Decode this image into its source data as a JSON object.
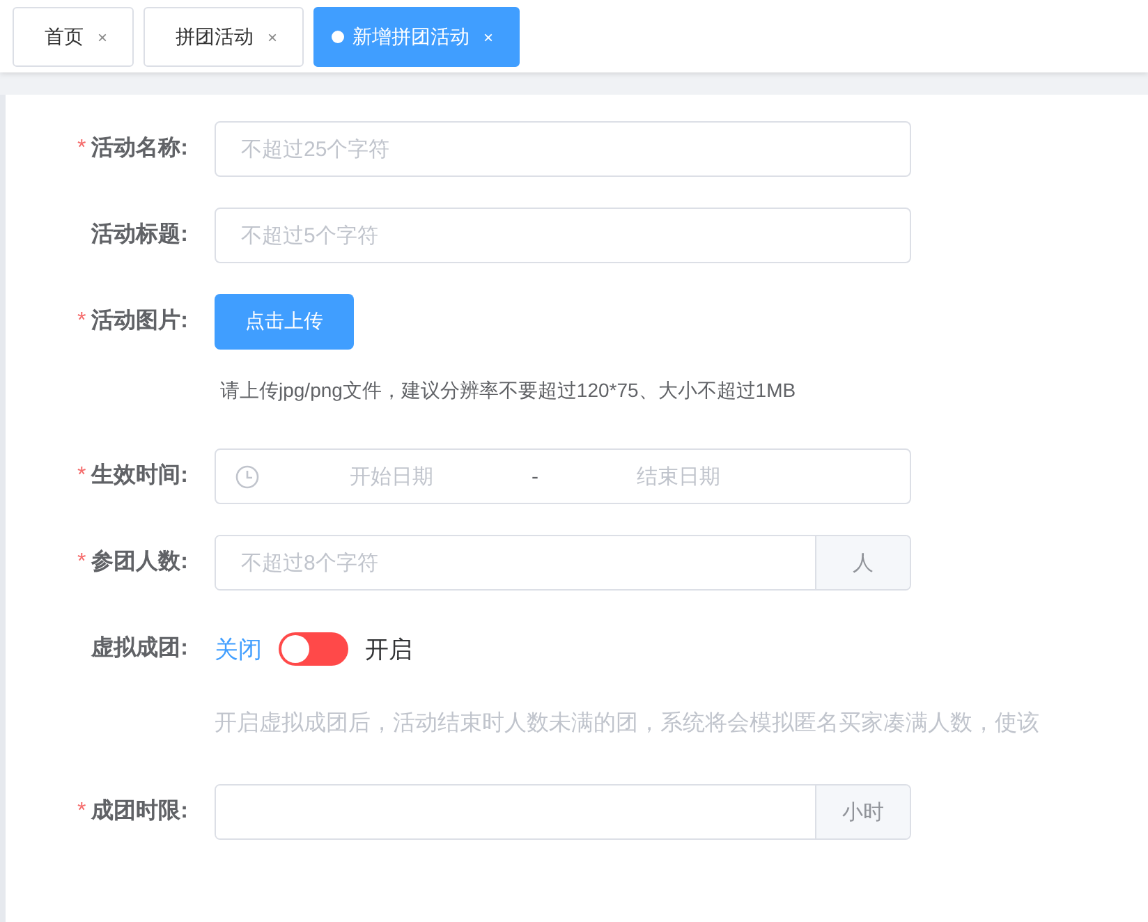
{
  "tabs": [
    {
      "label": "首页",
      "close": "×",
      "selected": false
    },
    {
      "label": "拼团活动",
      "close": "×",
      "selected": false
    },
    {
      "label": "新增拼团活动",
      "close": "×",
      "selected": true
    }
  ],
  "form": {
    "required_mark": "*",
    "fields": [
      {
        "kind": "text",
        "label": "活动名称:",
        "required": true,
        "placeholder": "不超过25个字符"
      },
      {
        "kind": "text",
        "label": "活动标题:",
        "required": false,
        "placeholder": "不超过5个字符"
      },
      {
        "kind": "upload",
        "label": "活动图片:",
        "required": true,
        "button": "点击上传",
        "hint": "请上传jpg/png文件，建议分辨率不要超过120*75、大小不超过1MB"
      },
      {
        "kind": "daterange",
        "label": "生效时间:",
        "required": true,
        "start_placeholder": "开始日期",
        "separator": "-",
        "end_placeholder": "结束日期"
      },
      {
        "kind": "append",
        "label": "参团人数:",
        "required": true,
        "placeholder": "不超过8个字符",
        "append": "人"
      },
      {
        "kind": "switch",
        "label": "虚拟成团:",
        "required": false,
        "off_label": "关闭",
        "on_label": "开启",
        "on": false,
        "description": "开启虚拟成团后，活动结束时人数未满的团，系统将会模拟匿名买家凑满人数，使该"
      },
      {
        "kind": "append",
        "label": "成团时限:",
        "required": true,
        "append": "小时"
      }
    ]
  }
}
